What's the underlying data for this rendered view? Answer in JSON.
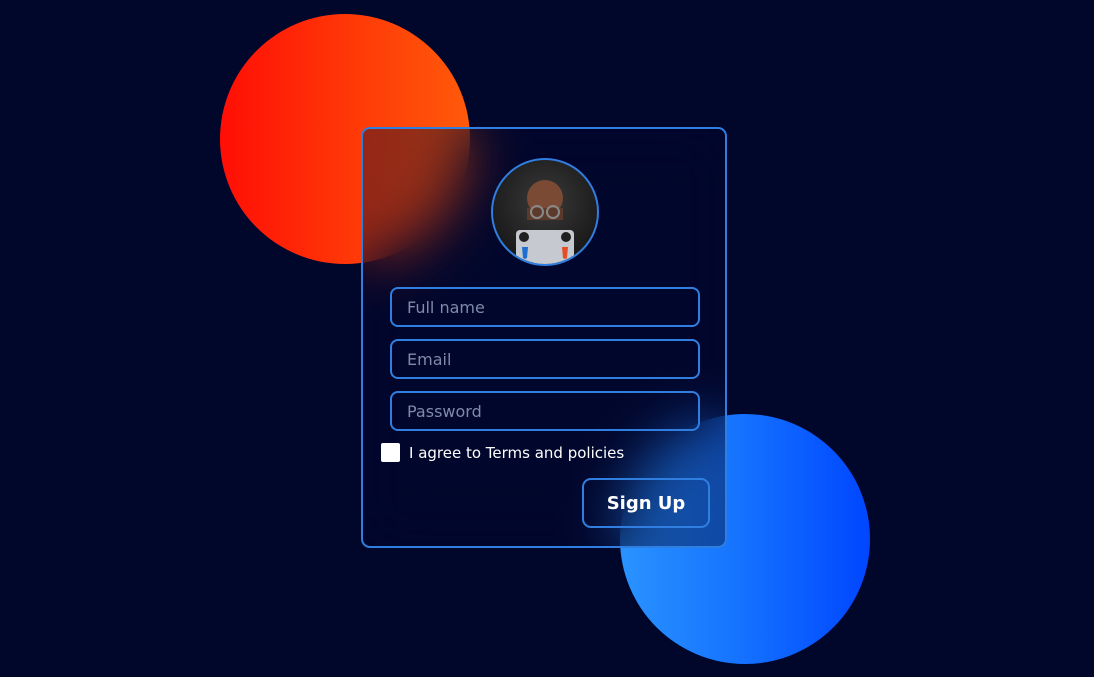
{
  "form": {
    "full_name": {
      "placeholder": "Full name",
      "value": ""
    },
    "email": {
      "placeholder": "Email",
      "value": ""
    },
    "password": {
      "placeholder": "Password",
      "value": ""
    },
    "terms_label": "I agree to Terms and policies",
    "terms_checked": false,
    "submit_label": "Sign Up"
  },
  "avatar": {
    "icon": "avatar-icon"
  },
  "colors": {
    "background": "#01062b",
    "accent": "#2f7ee0",
    "orange_circle": "#ff3a07",
    "blue_circle": "#1471ff"
  }
}
